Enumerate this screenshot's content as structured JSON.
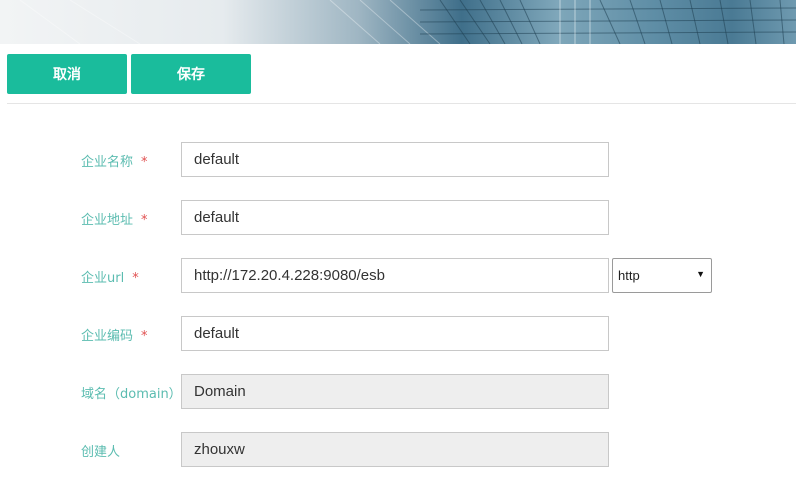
{
  "toolbar": {
    "cancel_label": "取消",
    "save_label": "保存"
  },
  "form": {
    "required_mark": "*",
    "fields": [
      {
        "label": "企业名称",
        "value": "default",
        "required": true,
        "readonly": false
      },
      {
        "label": "企业地址",
        "value": "default",
        "required": true,
        "readonly": false
      },
      {
        "label": "企业url",
        "value": "http://172.20.4.228:9080/esb",
        "required": true,
        "readonly": false
      },
      {
        "label": "企业编码",
        "value": "default",
        "required": true,
        "readonly": false
      },
      {
        "label": "域名（domain）",
        "value": "Domain",
        "required": false,
        "readonly": true
      },
      {
        "label": "创建人",
        "value": "zhouxw",
        "required": false,
        "readonly": true
      }
    ],
    "protocol_select": {
      "value": "http",
      "icon": "chevron-down-icon"
    }
  },
  "colors": {
    "accent": "#1abc9c",
    "label": "#5bbcb0",
    "required": "#e15050"
  }
}
